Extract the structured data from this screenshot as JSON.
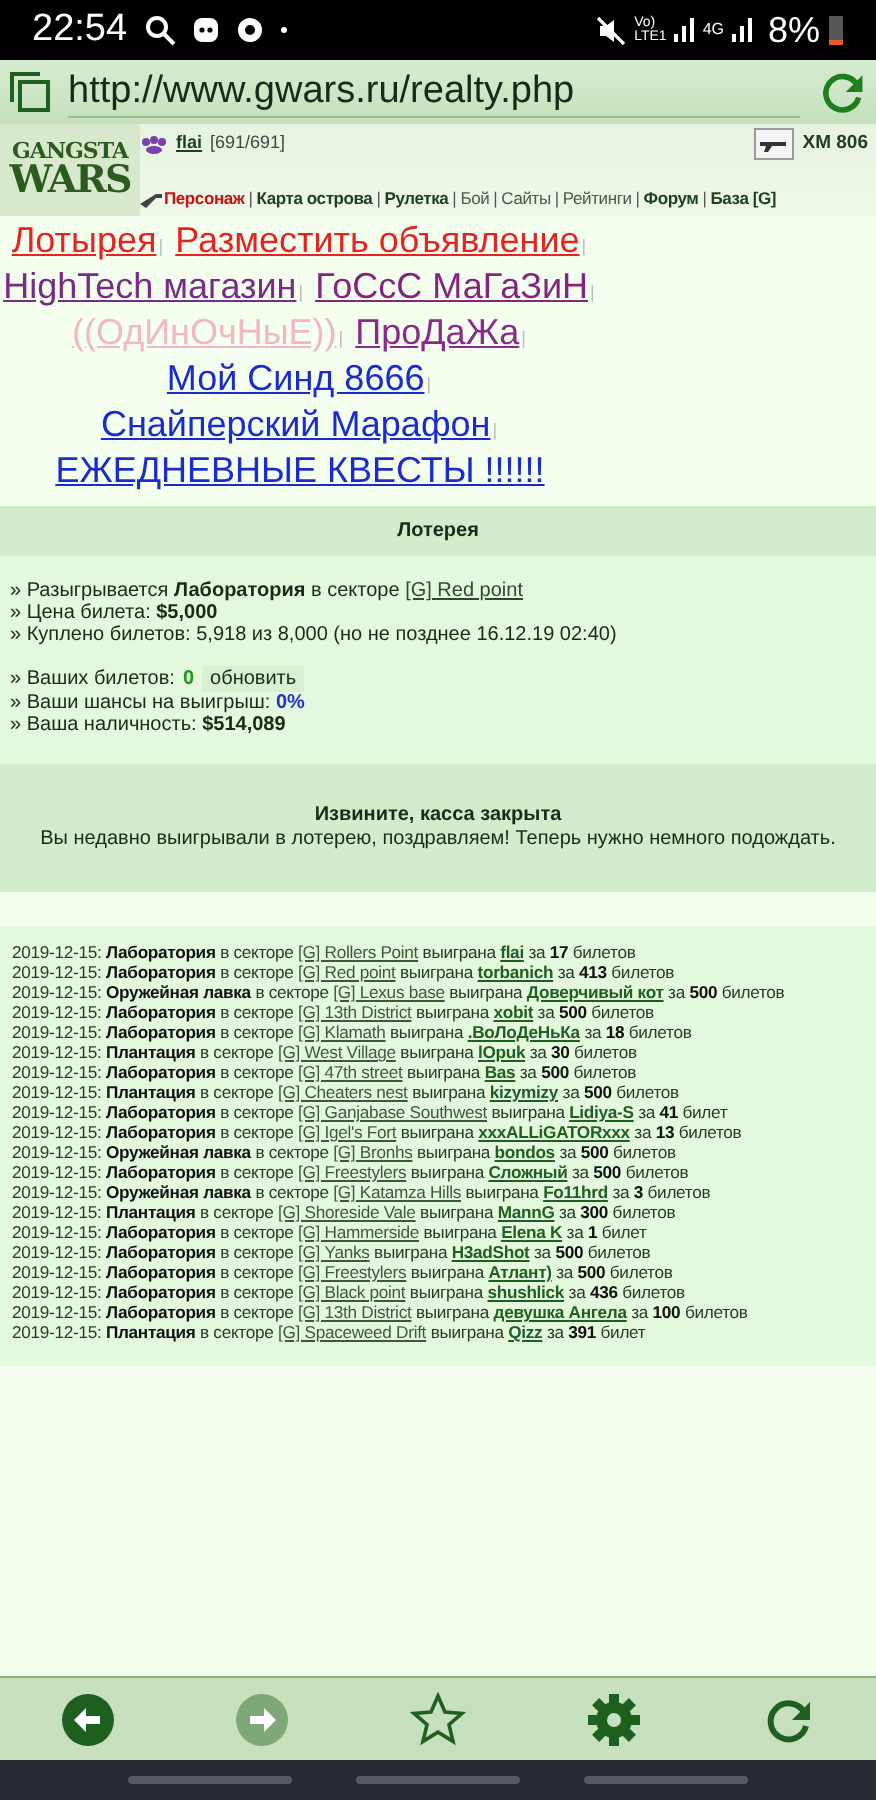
{
  "status_bar": {
    "time": "22:54",
    "volte": "Vo)",
    "lte": "LTE1",
    "network": "4G",
    "battery": "8%"
  },
  "address_bar": {
    "url": "http://www.gwars.ru/realty.php"
  },
  "header": {
    "logo": {
      "line1": "GANGSTA",
      "line2": "WARS"
    },
    "user": {
      "name": "flai",
      "hp": "[691/691]"
    },
    "weapon": "XM 806",
    "separator": "|",
    "menu": [
      {
        "label": "Персонаж",
        "kind": "current"
      },
      {
        "label": "Карта острова",
        "kind": "bold"
      },
      {
        "label": "Рулетка",
        "kind": "bold"
      },
      {
        "label": "Бой",
        "kind": "plain"
      },
      {
        "label": "Сайты",
        "kind": "plain"
      },
      {
        "label": "Рейтинги",
        "kind": "plain"
      },
      {
        "label": "Форум",
        "kind": "bold"
      },
      {
        "label": "База [G]",
        "kind": "bold"
      }
    ]
  },
  "ads": {
    "separator": "|",
    "items": [
      {
        "label": "Лотырея",
        "color": "#e8231f"
      },
      {
        "label": "Разместить объявление",
        "color": "#e8231f"
      },
      {
        "label": "HighTech магазин",
        "color": "#7a2a88"
      },
      {
        "label": "ГоСсС МаГаЗиН",
        "color": "#86237f"
      },
      {
        "label": "((ОдИнОчНыЕ))",
        "color": "#f3b6c3"
      },
      {
        "label": "ПроДаЖа",
        "color": "#8b2a8a"
      },
      {
        "label": "Мой Синд 8666",
        "color": "#1b2bd0"
      },
      {
        "label": "Снайперский Марафон",
        "color": "#1b2bd0"
      },
      {
        "label": "ЕЖЕДНЕВНЫЕ КВЕСТЫ !!!!!!",
        "color": "#1b2bd0"
      }
    ]
  },
  "lottery": {
    "title": "Лотерея",
    "prize": {
      "text": "» Разыгрывается **Лаборатория** в секторе",
      "link": "[G] Red point"
    },
    "price": "» Цена билета: **$5,000**",
    "bought": "» Куплено билетов: 5,918 из 8,000 (но не позднее 16.12.19 02:40)",
    "tickets": {
      "label": "» Ваших билетов:",
      "value": "0",
      "button": "обновить"
    },
    "chances": {
      "label": "» Ваши шансы на выигрыш:",
      "value": "0%"
    },
    "cash": "» Ваша наличность: **$514,089**",
    "closed": {
      "title": "Извините, касса закрыта",
      "message": "Вы недавно выигрывали в лотерею, поздравляем! Теперь нужно немного подождать."
    }
  },
  "history": {
    "rows": [
      {
        "date": "2019-12-15:",
        "building": "Лаборатория",
        "in_sector": "в секторе",
        "sector": "[G] Rollers Point",
        "won": "выиграна",
        "winner": "flai",
        "for": "за",
        "count": "17",
        "unit": "билетов"
      },
      {
        "date": "2019-12-15:",
        "building": "Лаборатория",
        "in_sector": "в секторе",
        "sector": "[G] Red point",
        "won": "выиграна",
        "winner": "torbanich",
        "for": "за",
        "count": "413",
        "unit": "билетов"
      },
      {
        "date": "2019-12-15:",
        "building": "Оружейная лавка",
        "in_sector": "в секторе",
        "sector": "[G] Lexus base",
        "won": "выиграна",
        "winner": "Доверчивый кот",
        "for": "за",
        "count": "500",
        "unit": "билетов"
      },
      {
        "date": "2019-12-15:",
        "building": "Лаборатория",
        "in_sector": "в секторе",
        "sector": "[G] 13th District",
        "won": "выиграна",
        "winner": "xobit",
        "for": "за",
        "count": "500",
        "unit": "билетов"
      },
      {
        "date": "2019-12-15:",
        "building": "Лаборатория",
        "in_sector": "в секторе",
        "sector": "[G] Klamath",
        "won": "выиграна",
        "winner": ".ВоЛоДеНьКа",
        "for": "за",
        "count": "18",
        "unit": "билетов"
      },
      {
        "date": "2019-12-15:",
        "building": "Плантация",
        "in_sector": "в секторе",
        "sector": "[G] West Village",
        "won": "выиграна",
        "winner": "lOpuk",
        "for": "за",
        "count": "30",
        "unit": "билетов"
      },
      {
        "date": "2019-12-15:",
        "building": "Лаборатория",
        "in_sector": "в секторе",
        "sector": "[G] 47th street",
        "won": "выиграна",
        "winner": "Bas",
        "for": "за",
        "count": "500",
        "unit": "билетов"
      },
      {
        "date": "2019-12-15:",
        "building": "Плантация",
        "in_sector": "в секторе",
        "sector": "[G] Cheaters nest",
        "won": "выиграна",
        "winner": "kizymizy",
        "for": "за",
        "count": "500",
        "unit": "билетов"
      },
      {
        "date": "2019-12-15:",
        "building": "Лаборатория",
        "in_sector": "в секторе",
        "sector": "[G] Ganjabase Southwest",
        "won": "выиграна",
        "winner": "Lidiya-S",
        "for": "за",
        "count": "41",
        "unit": "билет"
      },
      {
        "date": "2019-12-15:",
        "building": "Лаборатория",
        "in_sector": "в секторе",
        "sector": "[G] Igel's Fort",
        "won": "выиграна",
        "winner": "xxxALLiGATORxxx",
        "for": "за",
        "count": "13",
        "unit": "билетов"
      },
      {
        "date": "2019-12-15:",
        "building": "Оружейная лавка",
        "in_sector": "в секторе",
        "sector": "[G] Bronhs",
        "won": "выиграна",
        "winner": "bondos",
        "for": "за",
        "count": "500",
        "unit": "билетов"
      },
      {
        "date": "2019-12-15:",
        "building": "Лаборатория",
        "in_sector": "в секторе",
        "sector": "[G] Freestylers",
        "won": "выиграна",
        "winner": "Сложный",
        "for": "за",
        "count": "500",
        "unit": "билетов"
      },
      {
        "date": "2019-12-15:",
        "building": "Оружейная лавка",
        "in_sector": "в секторе",
        "sector": "[G] Katamza Hills",
        "won": "выиграна",
        "winner": "Fo11hrd",
        "for": "за",
        "count": "3",
        "unit": "билетов"
      },
      {
        "date": "2019-12-15:",
        "building": "Плантация",
        "in_sector": "в секторе",
        "sector": "[G] Shoreside Vale",
        "won": "выиграна",
        "winner": "MannG",
        "for": "за",
        "count": "300",
        "unit": "билетов"
      },
      {
        "date": "2019-12-15:",
        "building": "Лаборатория",
        "in_sector": "в секторе",
        "sector": "[G] Hammerside",
        "won": "выиграна",
        "winner": "Elena K",
        "for": "за",
        "count": "1",
        "unit": "билет"
      },
      {
        "date": "2019-12-15:",
        "building": "Лаборатория",
        "in_sector": "в секторе",
        "sector": "[G] Yanks",
        "won": "выиграна",
        "winner": "H3adShot",
        "for": "за",
        "count": "500",
        "unit": "билетов"
      },
      {
        "date": "2019-12-15:",
        "building": "Лаборатория",
        "in_sector": "в секторе",
        "sector": "[G] Freestylers",
        "won": "выиграна",
        "winner": "Атлант)",
        "for": "за",
        "count": "500",
        "unit": "билетов"
      },
      {
        "date": "2019-12-15:",
        "building": "Лаборатория",
        "in_sector": "в секторе",
        "sector": "[G] Black point",
        "won": "выиграна",
        "winner": "shushlick",
        "for": "за",
        "count": "436",
        "unit": "билетов"
      },
      {
        "date": "2019-12-15:",
        "building": "Лаборатория",
        "in_sector": "в секторе",
        "sector": "[G] 13th District",
        "won": "выиграна",
        "winner": "девушка Ангела",
        "for": "за",
        "count": "100",
        "unit": "билетов"
      },
      {
        "date": "2019-12-15:",
        "building": "Плантация",
        "in_sector": "в секторе",
        "sector": "[G] Spaceweed Drift",
        "won": "выиграна",
        "winner": "Qizz",
        "for": "за",
        "count": "391",
        "unit": "билет"
      }
    ]
  },
  "bottom_bar": [
    {
      "kind": "back",
      "disabled": false
    },
    {
      "kind": "forward",
      "disabled": true
    },
    {
      "kind": "bookmark",
      "disabled": false
    },
    {
      "kind": "settings",
      "disabled": false
    },
    {
      "kind": "reload",
      "disabled": false
    }
  ]
}
